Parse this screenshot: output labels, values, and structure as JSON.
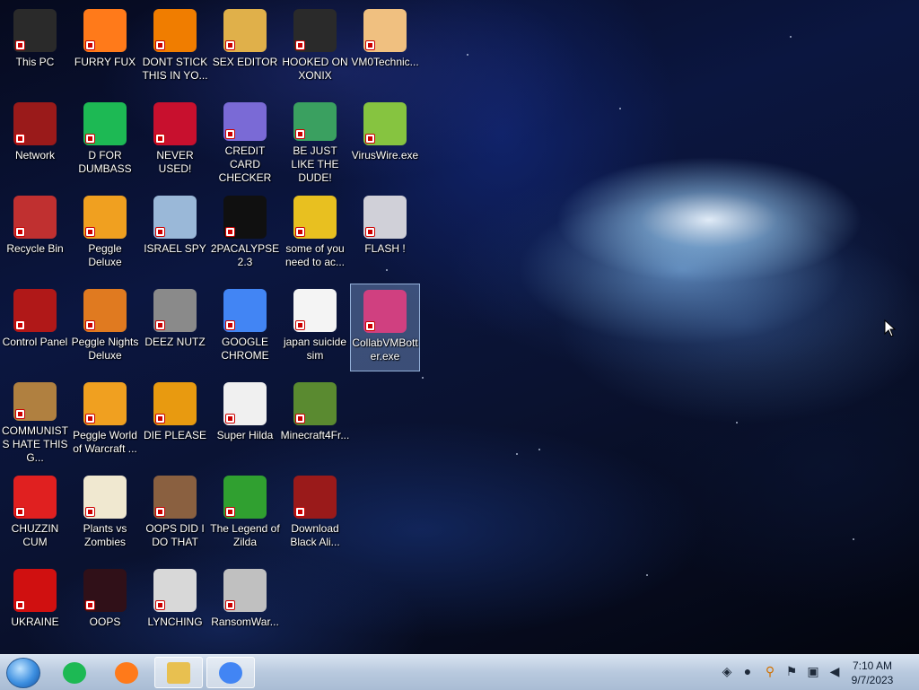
{
  "desktop": {
    "icons": [
      {
        "label": "This PC",
        "icon": "computer-icon",
        "color": "#2a2a2a"
      },
      {
        "label": "FURRY FUX",
        "icon": "firefox-icon",
        "color": "#ff7a1a"
      },
      {
        "label": "DONT STICK THIS IN YO...",
        "icon": "traffic-cone-icon",
        "color": "#f07d00"
      },
      {
        "label": "SEX EDITOR",
        "icon": "hxd-editor-icon",
        "color": "#e0b04a"
      },
      {
        "label": "HOOKED ON XONIX",
        "icon": "xonix-game-icon",
        "color": "#2a2a2a"
      },
      {
        "label": "VM0Technic...",
        "icon": "doctor-icon",
        "color": "#f0c080"
      },
      {
        "label": "Network",
        "icon": "network-orb-icon",
        "color": "#9a1a1a"
      },
      {
        "label": "D FOR DUMBASS",
        "icon": "chat-bubble-icon",
        "color": "#1db954"
      },
      {
        "label": "NEVER USED!",
        "icon": "dev-cpp-icon",
        "color": "#c8102e"
      },
      {
        "label": "CREDIT CARD CHECKER",
        "icon": "credit-card-icon",
        "color": "#7a6ad6"
      },
      {
        "label": "BE JUST LIKE THE DUDE!",
        "icon": "santa-elf-icon",
        "color": "#3aa060"
      },
      {
        "label": "VirusWire.exe",
        "icon": "lime-icon",
        "color": "#86c440"
      },
      {
        "label": "Recycle Bin",
        "icon": "recycle-bin-icon",
        "color": "#c03030"
      },
      {
        "label": "Peggle Deluxe",
        "icon": "peggle-icon",
        "color": "#f0a020"
      },
      {
        "label": "ISRAEL SPY",
        "icon": "network-monitor-icon",
        "color": "#9ab8d8"
      },
      {
        "label": "2PACALYPSE 2.3",
        "icon": "command-prompt-icon",
        "color": "#101010"
      },
      {
        "label": "some of you need to ac...",
        "icon": "cartoon-dog-icon",
        "color": "#e8c020"
      },
      {
        "label": "FLASH !",
        "icon": "flash-doc-icon",
        "color": "#d0d0d8"
      },
      {
        "label": "Control Panel",
        "icon": "control-panel-icon",
        "color": "#b01818"
      },
      {
        "label": "Peggle Nights Deluxe",
        "icon": "peggle-nights-icon",
        "color": "#e07a20"
      },
      {
        "label": "DEEZ NUTZ",
        "icon": "stacked-windows-icon",
        "color": "#8a8a8a"
      },
      {
        "label": "GOOGLE CHROME",
        "icon": "chrome-icon",
        "color": "#4285f4"
      },
      {
        "label": "japan suicide sim",
        "icon": "document-icon",
        "color": "#f4f4f4"
      },
      {
        "label": "CollabVMBotter.exe",
        "icon": "monitor-app-icon",
        "color": "#d04080"
      },
      {
        "label": "COMMUNISTS HATE THIS G...",
        "icon": "money-bag-icon",
        "color": "#b08040"
      },
      {
        "label": "Peggle World of Warcraft ...",
        "icon": "peggle-wow-icon",
        "color": "#f0a020"
      },
      {
        "label": "DIE PLEASE",
        "icon": "de-app-icon",
        "color": "#e89a10"
      },
      {
        "label": "Super Hilda",
        "icon": "pixel-character-icon",
        "color": "#f0f0f0"
      },
      {
        "label": "Minecraft4Fr...",
        "icon": "grass-block-icon",
        "color": "#5a8a30"
      },
      {
        "label": "CHUZZIN CUM",
        "icon": "chuzzle-icon",
        "color": "#e02020"
      },
      {
        "label": "Plants vs Zombies",
        "icon": "flower-icon",
        "color": "#f0e8d0"
      },
      {
        "label": "OOPS DID I DO THAT",
        "icon": "portrait-icon",
        "color": "#8a6040"
      },
      {
        "label": "The Legend of Zilda",
        "icon": "pixel-hero-icon",
        "color": "#30a030"
      },
      {
        "label": "Download Black Ali...",
        "icon": "network-orb-icon",
        "color": "#9a1a1a"
      },
      {
        "label": "UKRAINE",
        "icon": "radiation-icon",
        "color": "#d01010"
      },
      {
        "label": "OOPS",
        "icon": "dark-app-icon",
        "color": "#301018"
      },
      {
        "label": "LYNCHING",
        "icon": "noose-icon",
        "color": "#d8d8d8"
      },
      {
        "label": "RansomWar...",
        "icon": "skull-icon",
        "color": "#c0c0c0"
      }
    ]
  },
  "taskbar": {
    "start_icon": "start-orb-icon",
    "pinned": [
      {
        "name": "chat-app",
        "icon": "chat-bubble-icon",
        "color": "#1db954"
      },
      {
        "name": "firefox",
        "icon": "firefox-icon",
        "color": "#ff7a1a"
      },
      {
        "name": "file-explorer",
        "icon": "folder-icon",
        "color": "#e8c050",
        "active": true
      },
      {
        "name": "chrome",
        "icon": "chrome-icon",
        "color": "#4285f4",
        "active": true
      }
    ],
    "tray": [
      "security-shield-icon",
      "water-drop-icon",
      "search-key-icon",
      "flag-icon",
      "network-icon",
      "speaker-icon"
    ],
    "clock": {
      "time": "7:10 AM",
      "date": "9/7/2023"
    }
  }
}
